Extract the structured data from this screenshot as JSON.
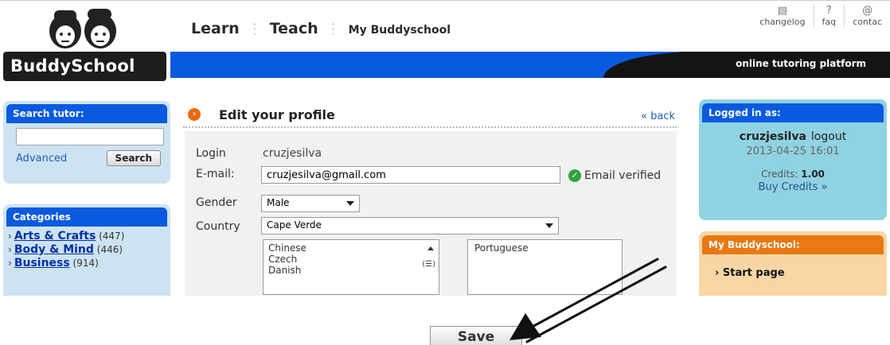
{
  "brand": {
    "name": "BuddySchool",
    "tagline": "online tutoring platform"
  },
  "nav": {
    "learn": "Learn",
    "teach": "Teach",
    "my": "My Buddyschool",
    "sep": "⋮"
  },
  "toplinks": {
    "changelog": "changelog",
    "faq": "faq",
    "contact": "contac"
  },
  "search": {
    "title": "Search tutor:",
    "value": "",
    "advanced": "Advanced",
    "button": "Search"
  },
  "categories": {
    "title": "Categories",
    "items": [
      {
        "name": "Arts & Crafts",
        "count": "(447)"
      },
      {
        "name": "Body & Mind",
        "count": "(446)"
      },
      {
        "name": "Business",
        "count": "(914)"
      }
    ]
  },
  "profile": {
    "title": "Edit your profile",
    "back": "« back",
    "login_label": "Login",
    "login_value": "cruzjesilva",
    "email_label": "E-mail:",
    "email_value": "cruzjesilva@gmail.com",
    "email_status": "Email verified",
    "gender_label": "Gender",
    "gender_value": "Male",
    "country_label": "Country",
    "country_value": "Cape Verde",
    "languages_available": [
      "Chinese",
      "Czech",
      "Danish"
    ],
    "languages_selected": [
      "Portuguese"
    ]
  },
  "account": {
    "title": "Logged in as:",
    "username": "cruzjesilva",
    "logout": "logout",
    "datetime": "2013-04-25 16:01",
    "credits_label": "Credits:",
    "credits_value": "1.00",
    "buy": "Buy Credits »"
  },
  "mybuddyschool": {
    "title": "My Buddyschool:",
    "start": "› Start page"
  },
  "save_button": "Save"
}
